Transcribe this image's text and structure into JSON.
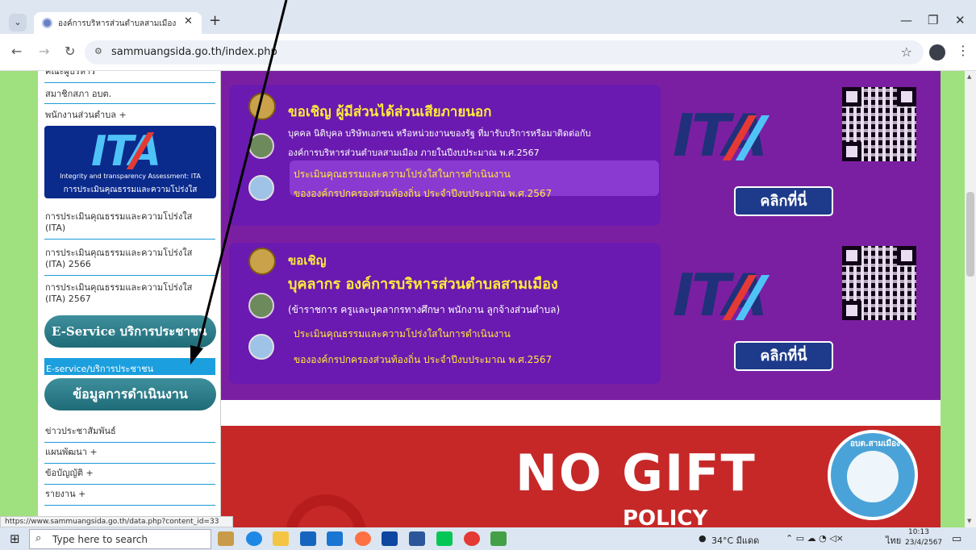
{
  "browser": {
    "tab_title": "องค์การบริหารส่วนตำบลสามเมือง อำ",
    "url": "sammuangsida.go.th/index.php",
    "status_url": "https://www.sammuangsida.go.th/data.php?content_id=33"
  },
  "sidebar": {
    "items_top": [
      "คณะผู้บริหาร",
      "สมาชิกสภา อบต.",
      "พนักงานส่วนตำบล +"
    ],
    "ita_banner": {
      "logo_text": "ITA",
      "subtitle_en": "Integrity and transparency Assessment: ITA",
      "subtitle_th": "การประเมินคุณธรรมและความโปร่งใส"
    },
    "ita_links": [
      "การประเมินคุณธรรมและความโปร่งใส (ITA)",
      "การประเมินคุณธรรมและความโปร่งใส (ITA) 2566",
      "การประเมินคุณธรรมและความโปร่งใส (ITA) 2567"
    ],
    "eservice_button": "E-Service บริการประชาชน",
    "eservice_link": "E-service/บริการประชาชน",
    "operations_button": "ข้อมูลการดำเนินงาน",
    "items_bottom": [
      "ข่าวประชาสัมพันธ์",
      "แผนพัฒนา +",
      "ข้อบัญญัติ +",
      "รายงาน +"
    ]
  },
  "main": {
    "card1": {
      "title": "ขอเชิญ ผู้มีส่วนได้ส่วนเสียภายนอก",
      "line1": "บุคคล นิติบุคล บริษัทเอกชน หรือหน่วยงานของรัฐ ที่มารับบริการหรือมาติดต่อกับ",
      "line2": "องค์การบริหารส่วนตำบลสามเมือง ภายในปีงบประมาณ พ.ศ.2567",
      "highlight1": "ประเมินคุณธรรมและความโปร่งใสในการดำเนินงาน",
      "highlight2": "ขององค์กรปกครองส่วนท้องถิ่น ประจำปีงบประมาณ พ.ศ.2567"
    },
    "card2": {
      "title1": "ขอเชิญ",
      "title2": "บุคลากร องค์การบริหารส่วนตำบลสามเมือง",
      "line1": "(ข้าราชการ ครูและบุคลากรทางศึกษา พนักงาน ลูกจ้างส่วนตำบล)",
      "highlight1": "ประเมินคุณธรรมและความโปร่งใสในการดำเนินงาน",
      "highlight2": "ขององค์กรปกครองส่วนท้องถิ่น ประจำปีงบประมาณ พ.ศ.2567"
    },
    "ita_logo": "ITA",
    "click_label": "คลิกที่นี่",
    "nogift": {
      "title": "NO GIFT",
      "policy": "POLICY",
      "seal_text": "อบต.สามเมือง"
    }
  },
  "taskbar": {
    "search_placeholder": "Type here to search",
    "weather": "34°C มีแดด",
    "lang": "ไทย",
    "time": "10:13",
    "date": "23/4/2567"
  },
  "colors": {
    "accent_purple": "#7b1fa2",
    "yellow": "#ffeb3b",
    "side_green": "#9fe07f",
    "link_blue": "#1b9fde",
    "red": "#c62828"
  }
}
